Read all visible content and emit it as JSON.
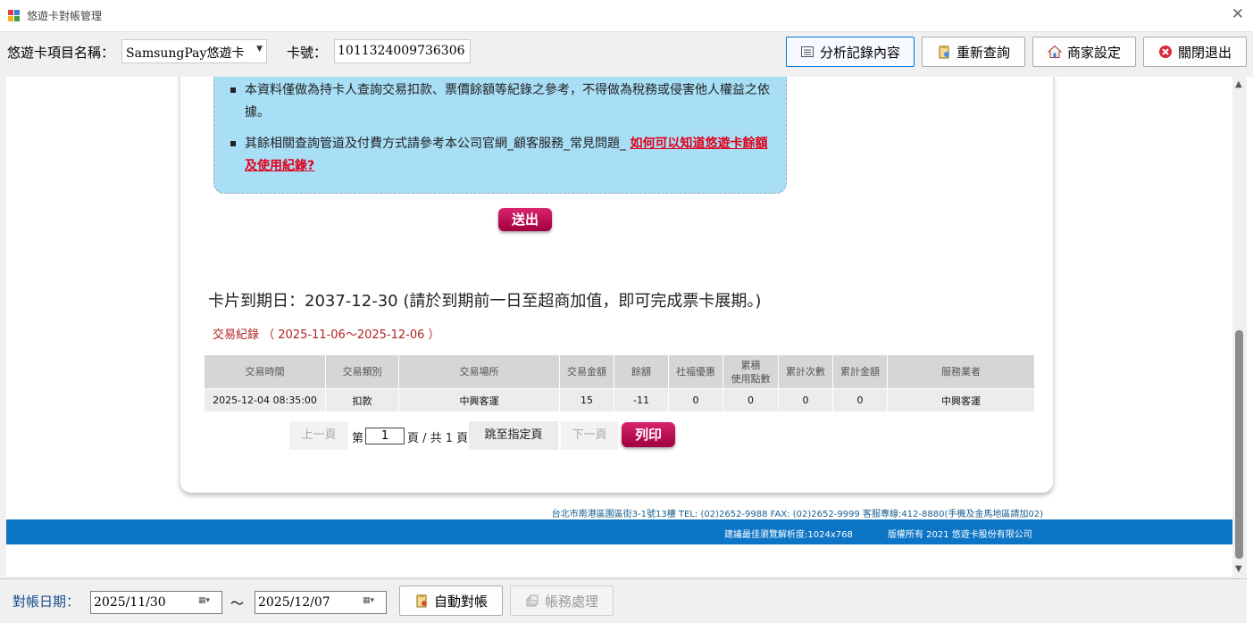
{
  "window": {
    "title": "悠遊卡對帳管理",
    "close_glyph": "✕"
  },
  "toolbar": {
    "item_label": "悠遊卡項目名稱：",
    "item_value": "SamsungPay悠遊卡",
    "card_label": "卡號：",
    "card_value": "1011324009736306",
    "buttons": {
      "analyze": "分析記錄內容",
      "requery": "重新查詢",
      "merchant": "商家設定",
      "exit": "關閉退出"
    }
  },
  "notice": {
    "item1": "本資料僅做為持卡人查詢交易扣款、票價餘額等紀錄之參考，不得做為稅務或侵害他人權益之依據。",
    "item2_text": "其餘相關查詢管道及付費方式請參考本公司官網_顧客服務_常見問題_ ",
    "item2_link": "如何可以知道悠遊卡餘額及使用紀錄?"
  },
  "submit_label": "送出",
  "expiry_text": "卡片到期日：2037-12-30 (請於到期前一日至超商加值，即可完成票卡展期。)",
  "range_text": "交易紀錄 （ 2025-11-06～2025-12-06 ）",
  "table": {
    "headers": [
      "交易時間",
      "交易類別",
      "交易場所",
      "交易金額",
      "餘額",
      "社福優惠",
      "累積\n使用點數",
      "累計次數",
      "累計金額",
      "服務業者"
    ],
    "rows": [
      [
        "2025-12-04 08:35:00",
        "扣款",
        "中興客運",
        "15",
        "-11",
        "0",
        "0",
        "0",
        "0",
        "中興客運"
      ]
    ]
  },
  "pager": {
    "prev": "上一頁",
    "page_prefix": "第",
    "current_page": "1",
    "page_suffix": "頁 / 共 1 頁",
    "jump": "跳至指定頁",
    "next": "下一頁",
    "print": "列印"
  },
  "footer": {
    "address": "台北市南港區園區街3-1號13樓 TEL: (02)2652-9988  FAX: (02)2652-9999 客服專線:412-8880(手機及金馬地區請加02)",
    "resolution": "建議最佳瀏覽解析度:1024x768",
    "copyright": "版權所有 2021 悠遊卡股份有限公司"
  },
  "bottom": {
    "date_label": "對帳日期：",
    "date_from": "2025/11/30",
    "tilde": "～",
    "date_to": "2025/12/07",
    "auto_reconcile": "自動對帳",
    "accounting": "帳務處理"
  },
  "colors": {
    "accent_blue": "#0d75c6",
    "notice_bg": "#a8dff6",
    "button_magenta": "#c0105a",
    "link_red": "#e0001a"
  }
}
